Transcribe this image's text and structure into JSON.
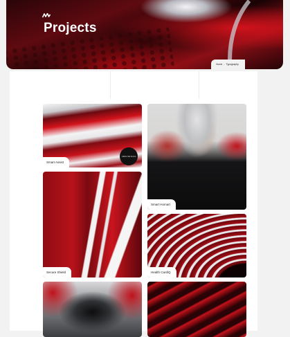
{
  "hero": {
    "title": "Projects",
    "breadcrumb": {
      "home": "Home",
      "separator": "-",
      "current": "Typography"
    }
  },
  "cards": [
    {
      "label": "Smart Assist",
      "badge": "VIEW DETAILS"
    },
    {
      "label": "Smart Homart"
    },
    {
      "label": "Secure Shield"
    },
    {
      "label": "Health CardiQ"
    },
    {
      "label": ""
    },
    {
      "label": ""
    }
  ],
  "icons": {
    "logo": "brand-wave-icon"
  },
  "colors": {
    "accent": "#c8121c",
    "surface": "#ffffff",
    "background": "#f2f2f2"
  }
}
